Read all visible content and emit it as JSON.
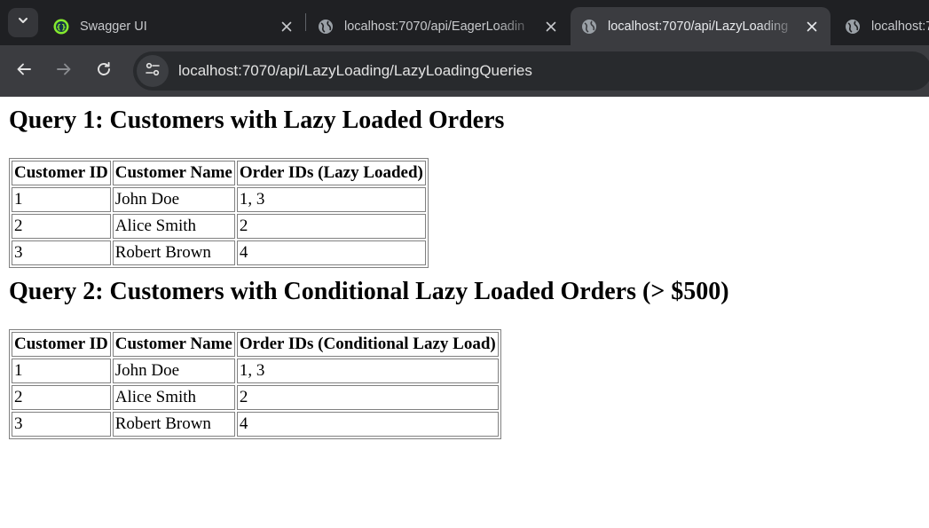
{
  "browser": {
    "tabs": [
      {
        "title": "Swagger UI",
        "favicon": "swagger-icon",
        "active": false
      },
      {
        "title": "localhost:7070/api/EagerLoadin",
        "favicon": "globe-icon",
        "active": false
      },
      {
        "title": "localhost:7070/api/LazyLoading",
        "favicon": "globe-icon",
        "active": true
      },
      {
        "title": "localhost:7",
        "favicon": "globe-icon",
        "active": false
      }
    ],
    "url": "localhost:7070/api/LazyLoading/LazyLoadingQueries",
    "colors": {
      "tabstrip": "#1f2023",
      "toolbar": "#3b3c40",
      "omnibox": "#282a2d",
      "swagger": "#85ea2d"
    }
  },
  "page": {
    "query1": {
      "title": "Query 1: Customers with Lazy Loaded Orders",
      "headers": [
        "Customer ID",
        "Customer Name",
        "Order IDs (Lazy Loaded)"
      ],
      "rows": [
        [
          "1",
          "John Doe",
          "1, 3"
        ],
        [
          "2",
          "Alice Smith",
          "2"
        ],
        [
          "3",
          "Robert Brown",
          "4"
        ]
      ]
    },
    "query2": {
      "title": "Query 2: Customers with Conditional Lazy Loaded Orders (> $500)",
      "headers": [
        "Customer ID",
        "Customer Name",
        "Order IDs (Conditional Lazy Load)"
      ],
      "rows": [
        [
          "1",
          "John Doe",
          "1, 3"
        ],
        [
          "2",
          "Alice Smith",
          "2"
        ],
        [
          "3",
          "Robert Brown",
          "4"
        ]
      ]
    }
  }
}
